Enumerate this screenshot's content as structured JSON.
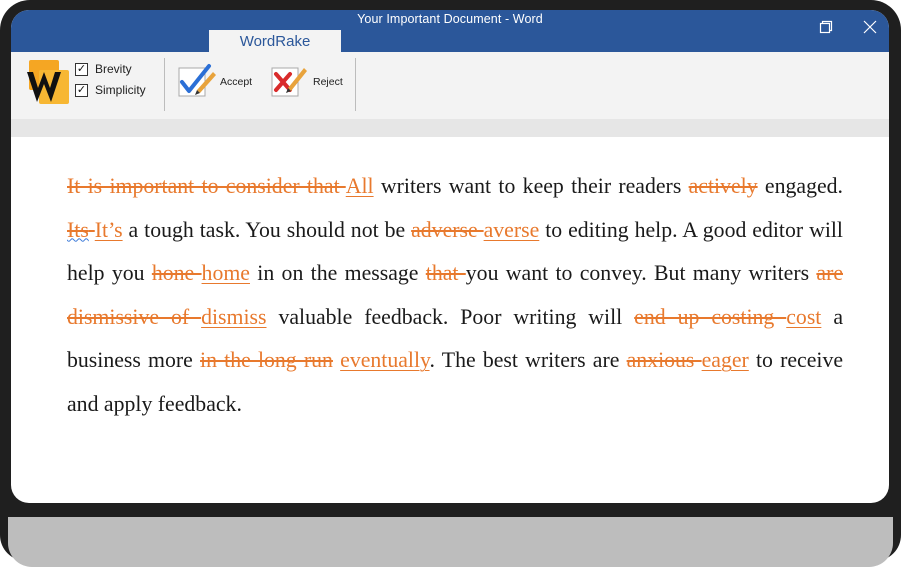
{
  "window": {
    "title": "Your Important Document - Word",
    "active_tab": "WordRake",
    "restore_icon": "restore-icon",
    "close_icon": "close-icon"
  },
  "ribbon": {
    "logo_icon": "wordrake-logo",
    "options": [
      {
        "label": "Brevity",
        "checked": true
      },
      {
        "label": "Simplicity",
        "checked": true
      }
    ],
    "accept_label": "Accept",
    "reject_label": "Reject"
  },
  "document": {
    "colors": {
      "edit": "#e8792d",
      "text": "#1a1a1a",
      "accent": "#2b579a"
    },
    "segments": [
      {
        "t": "del",
        "text": "It is important to consider that "
      },
      {
        "t": "ins",
        "text": "All"
      },
      {
        "t": "txt",
        "text": " writers want to keep their readers "
      },
      {
        "t": "del",
        "text": "actively"
      },
      {
        "t": "txt",
        "text": " engaged. "
      },
      {
        "t": "delsq",
        "text": "Its"
      },
      {
        "t": "del",
        "text": " "
      },
      {
        "t": "ins",
        "text": "It’s"
      },
      {
        "t": "txt",
        "text": " a tough task. You should not be "
      },
      {
        "t": "del",
        "text": "adverse "
      },
      {
        "t": "ins",
        "text": "averse"
      },
      {
        "t": "txt",
        "text": " to editing help. A good editor will help you "
      },
      {
        "t": "del",
        "text": "hone "
      },
      {
        "t": "ins",
        "text": "home"
      },
      {
        "t": "txt",
        "text": " in on the message "
      },
      {
        "t": "del",
        "text": "that "
      },
      {
        "t": "txt",
        "text": "you want to convey. But many writers "
      },
      {
        "t": "del",
        "text": "are dismissive of "
      },
      {
        "t": "ins",
        "text": "dismiss"
      },
      {
        "t": "txt",
        "text": " valuable feedback. Poor writing will "
      },
      {
        "t": "del",
        "text": "end up costing "
      },
      {
        "t": "ins",
        "text": "cost"
      },
      {
        "t": "txt",
        "text": " a business more "
      },
      {
        "t": "del",
        "text": "in the long run"
      },
      {
        "t": "txt",
        "text": " "
      },
      {
        "t": "ins",
        "text": "eventually"
      },
      {
        "t": "txt",
        "text": ". The best writers are "
      },
      {
        "t": "del",
        "text": "anxious "
      },
      {
        "t": "ins",
        "text": "eager"
      },
      {
        "t": "txt",
        "text": " to receive and apply feedback."
      }
    ]
  }
}
